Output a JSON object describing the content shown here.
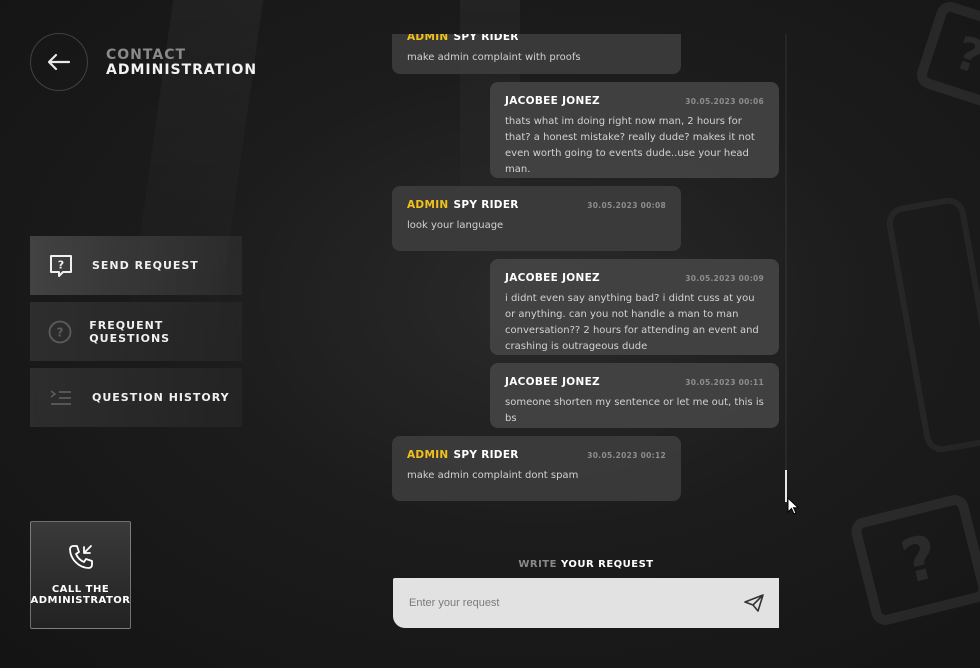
{
  "header": {
    "title_line1": "CONTACT",
    "title_line2": "ADMINISTRATION"
  },
  "menu": [
    {
      "label": "SEND REQUEST",
      "icon": "question-bubble-icon",
      "active": true
    },
    {
      "label": "FREQUENT QUESTIONS",
      "icon": "question-circle-icon",
      "active": false
    },
    {
      "label": "QUESTION HISTORY",
      "icon": "list-indent-icon",
      "active": false
    }
  ],
  "call": {
    "line1": "CALL THE",
    "line2": "ADMINISTRATOR",
    "icon": "phone-incoming-icon"
  },
  "chat": {
    "messages": [
      {
        "role": "ADMIN",
        "author": "SPY RIDER",
        "time": "",
        "text": "make admin complaint with proofs"
      },
      {
        "role": "",
        "author": "JACOBEE JONEZ",
        "time": "30.05.2023 00:06",
        "text": "thats what im doing right now man, 2 hours for that? a honest mistake? really dude? makes it not even worth going to events dude..use your head man."
      },
      {
        "role": "ADMIN",
        "author": "SPY RIDER",
        "time": "30.05.2023 00:08",
        "text": "look your language"
      },
      {
        "role": "",
        "author": "JACOBEE JONEZ",
        "time": "30.05.2023 00:09",
        "text": "i didnt even say anything bad? i didnt cuss at you or anything. can you not handle a man to man conversation?? 2 hours for attending an event and crashing is outrageous dude"
      },
      {
        "role": "",
        "author": "JACOBEE JONEZ",
        "time": "30.05.2023 00:11",
        "text": "someone shorten my sentence or let me out, this is bs"
      },
      {
        "role": "ADMIN",
        "author": "SPY RIDER",
        "time": "30.05.2023 00:12",
        "text": "make admin complaint dont spam"
      }
    ]
  },
  "composer": {
    "label_dim": "WRITE",
    "label_bright": "YOUR REQUEST",
    "placeholder": "Enter your request",
    "value": ""
  },
  "colors": {
    "accent": "#f2c21b",
    "bubble_admin": "#3e3e3e",
    "bubble_user": "#464646",
    "input_bg": "#e2e2e2"
  }
}
